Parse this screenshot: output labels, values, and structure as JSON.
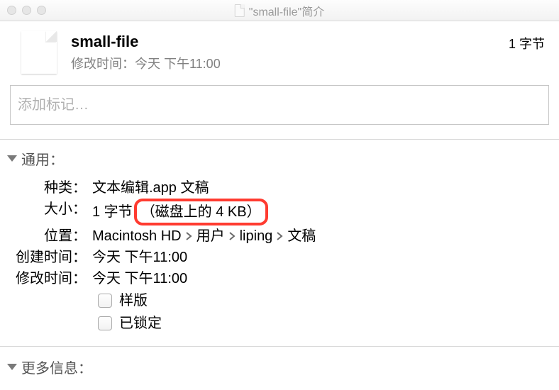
{
  "titlebar": {
    "title": "\"small-file\"简介"
  },
  "header": {
    "filename": "small-file",
    "modified_prefix": "修改时间：",
    "modified_value": "今天 下午11:00",
    "size": "1 字节"
  },
  "tags": {
    "placeholder": "添加标记…"
  },
  "general": {
    "title": "通用：",
    "kind_label": "种类：",
    "kind_value": "文本编辑.app 文稿",
    "size_label": "大小：",
    "size_value": "1 字节",
    "size_disk": "（磁盘上的 4 KB）",
    "where_label": "位置：",
    "where_parts": [
      "Macintosh HD",
      "用户",
      "liping",
      "文稿"
    ],
    "created_label": "创建时间：",
    "created_value": "今天 下午11:00",
    "modified_label": "修改时间：",
    "modified_value": "今天 下午11:00",
    "stationery_label": "样版",
    "locked_label": "已锁定"
  },
  "more": {
    "title": "更多信息："
  }
}
